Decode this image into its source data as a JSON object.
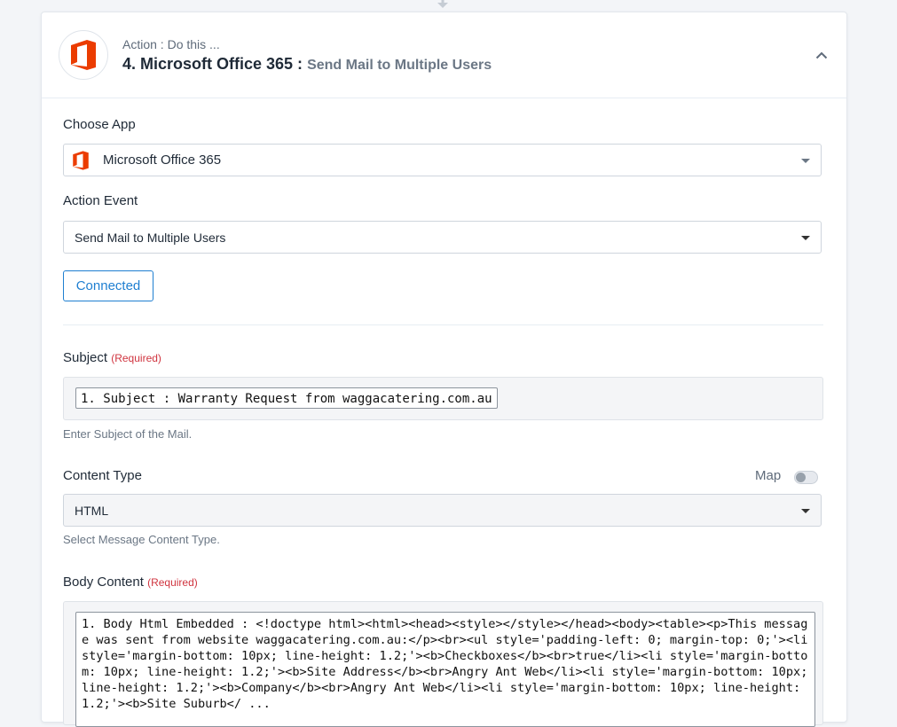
{
  "header": {
    "kicker": "Action : Do this ...",
    "title": "4. Microsoft Office 365 :",
    "subtitle": "Send Mail to Multiple Users"
  },
  "choose_app": {
    "label": "Choose App",
    "value": "Microsoft Office 365"
  },
  "action_event": {
    "label": "Action Event",
    "value": "Send Mail to Multiple Users"
  },
  "connection": {
    "button_label": "Connected"
  },
  "subject": {
    "label": "Subject",
    "required": "(Required)",
    "token": "1. Subject : Warranty Request from waggacatering.com.au",
    "help": "Enter Subject of the Mail."
  },
  "content_type": {
    "label": "Content Type",
    "map_label": "Map",
    "map_enabled": false,
    "value": "HTML",
    "help": "Select Message Content Type."
  },
  "body_content": {
    "label": "Body Content",
    "required": "(Required)",
    "value": "1. Body Html Embedded : <!doctype html><html><head><style></style></head><body><table><p>This message was sent from website waggacatering.com.au:</p><br><ul style='padding-left: 0; margin-top: 0;'><li style='margin-bottom: 10px; line-height: 1.2;'><b>Checkboxes</b><br>true</li><li style='margin-bottom: 10px; line-height: 1.2;'><b>Site Address</b><br>Angry Ant Web</li><li style='margin-bottom: 10px; line-height: 1.2;'><b>Company</b><br>Angry Ant Web</li><li style='margin-bottom: 10px; line-height: 1.2;'><b>Site Suburb</ ..."
  },
  "colors": {
    "office_orange": "#eb3c00",
    "link_blue": "#1f7fd1",
    "required_red": "#d0343f"
  },
  "icons": {
    "app_logo": "office365-icon",
    "collapse": "chevron-up-icon",
    "dropdown": "caret-down-icon"
  }
}
